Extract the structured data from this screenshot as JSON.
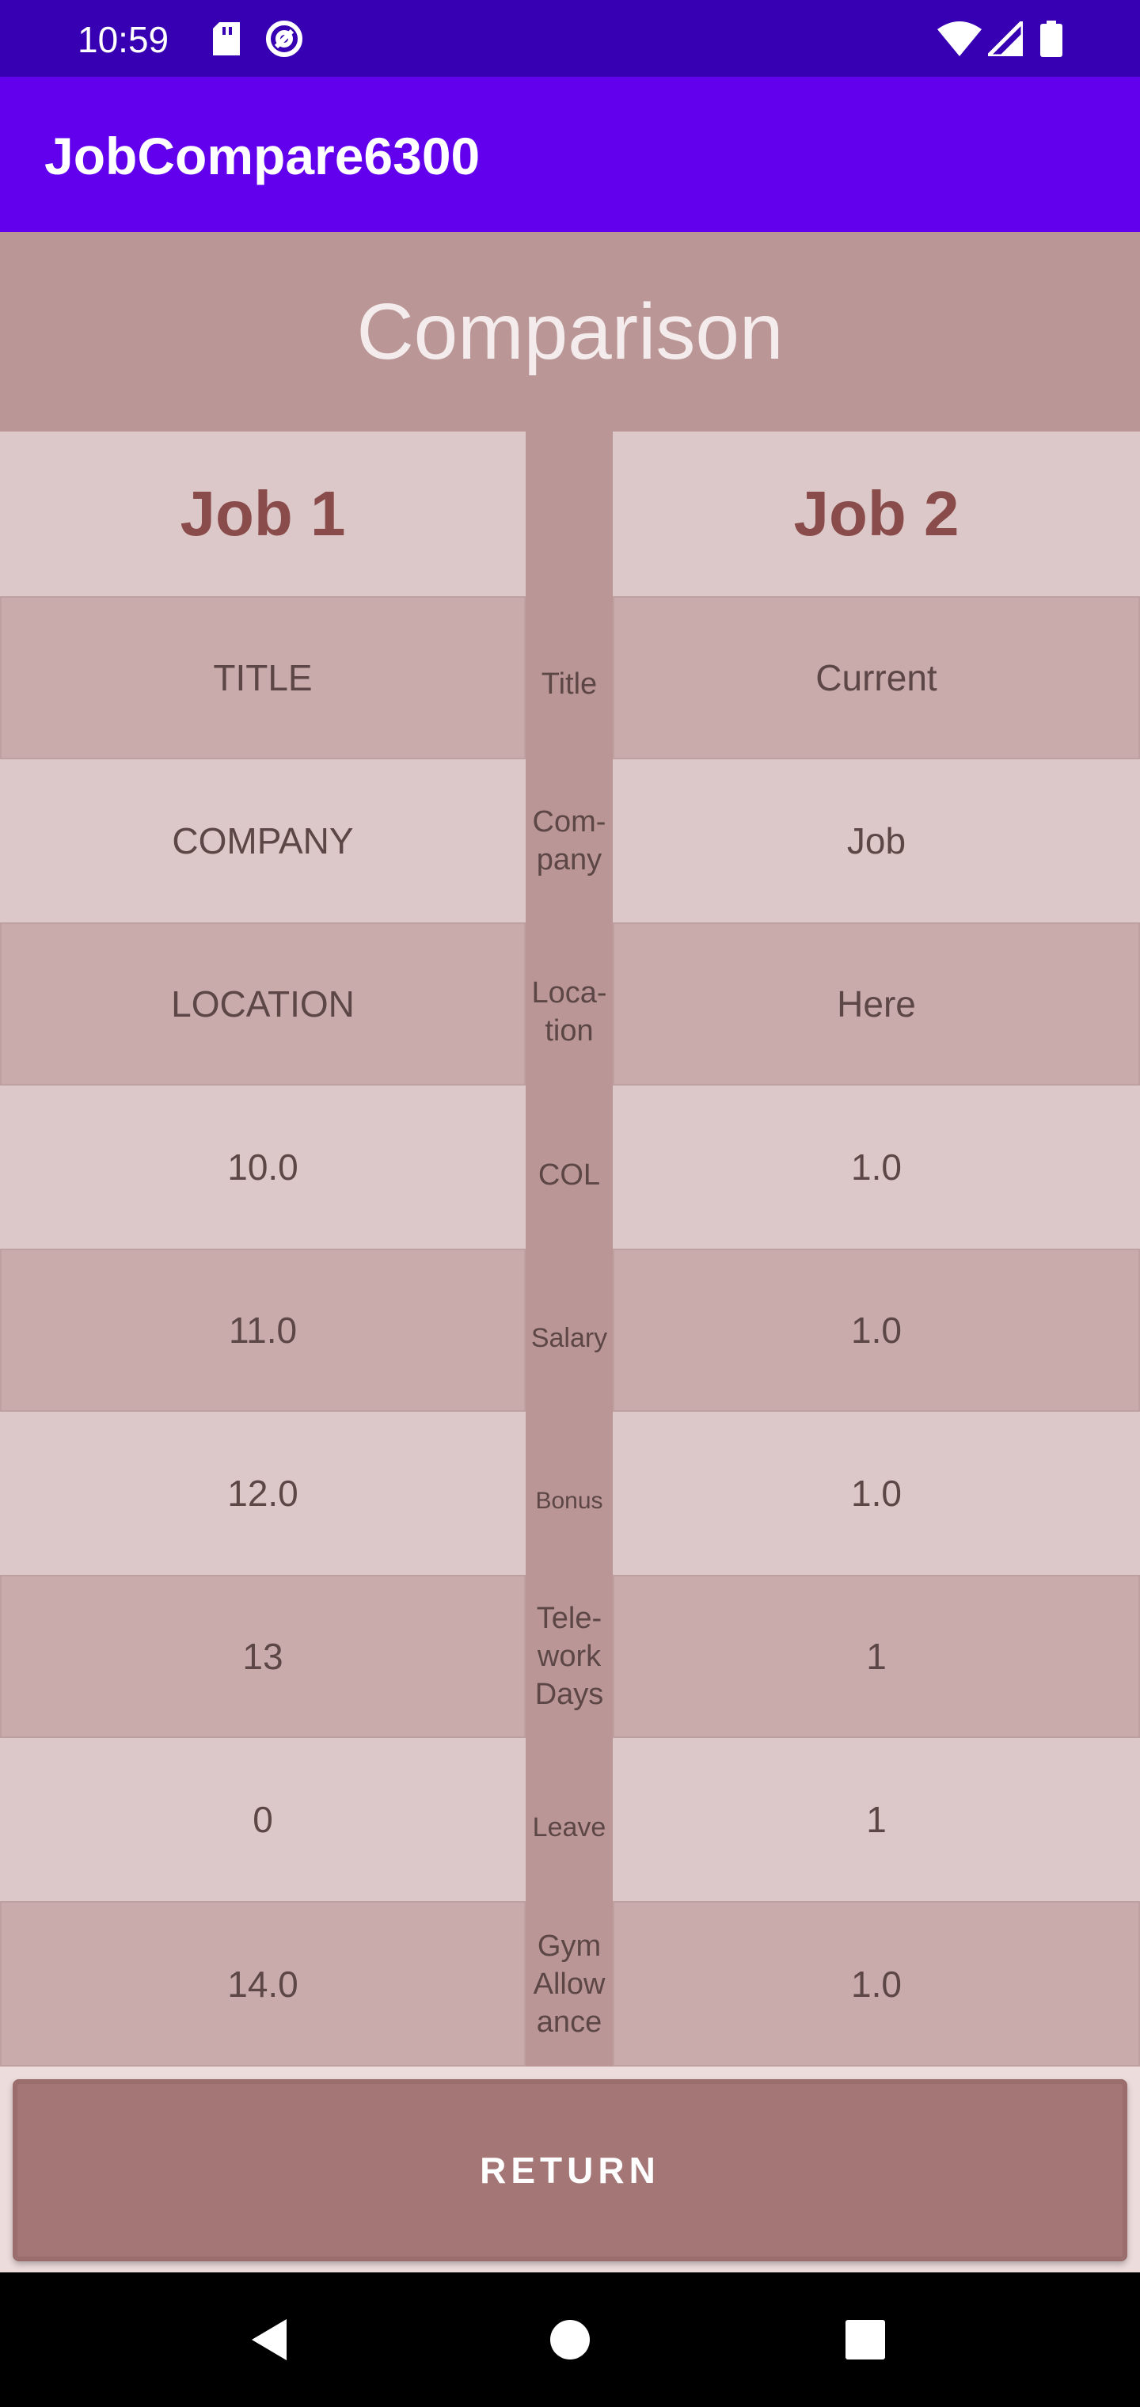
{
  "status_bar": {
    "time": "10:59",
    "icons": [
      "sd-card-icon",
      "at-sign-icon",
      "wifi-icon",
      "signal-icon",
      "battery-icon"
    ]
  },
  "app_bar": {
    "title": "JobCompare6300"
  },
  "banner": {
    "title": "Comparison"
  },
  "columns": {
    "job1_header": "Job 1",
    "job2_header": "Job 2"
  },
  "rows": [
    {
      "label": "Title",
      "job1": "TITLE",
      "job2": "Current"
    },
    {
      "label": "Com-\npany",
      "job1": "COMPANY",
      "job2": "Job"
    },
    {
      "label": "Loca-\ntion",
      "job1": "LOCATION",
      "job2": "Here"
    },
    {
      "label": "COL",
      "job1": "10.0",
      "job2": "1.0"
    },
    {
      "label": "Salary",
      "job1": "11.0",
      "job2": "1.0"
    },
    {
      "label": "Bonus",
      "job1": "12.0",
      "job2": "1.0"
    },
    {
      "label": "Tele-\nwork\nDays",
      "job1": "13",
      "job2": "1"
    },
    {
      "label": "Leave",
      "job1": "0",
      "job2": "1"
    },
    {
      "label": "Gym\nAllow\nance",
      "job1": "14.0",
      "job2": "1.0"
    }
  ],
  "return_button": {
    "label": "RETURN"
  },
  "nav_bar": {
    "buttons": [
      "back-icon",
      "home-icon",
      "recents-icon"
    ]
  },
  "colors": {
    "status_bar": "#3700b3",
    "app_bar": "#6200ee",
    "banner": "#bb9696",
    "header_text": "#8a4b4b",
    "button": "#a47676"
  }
}
